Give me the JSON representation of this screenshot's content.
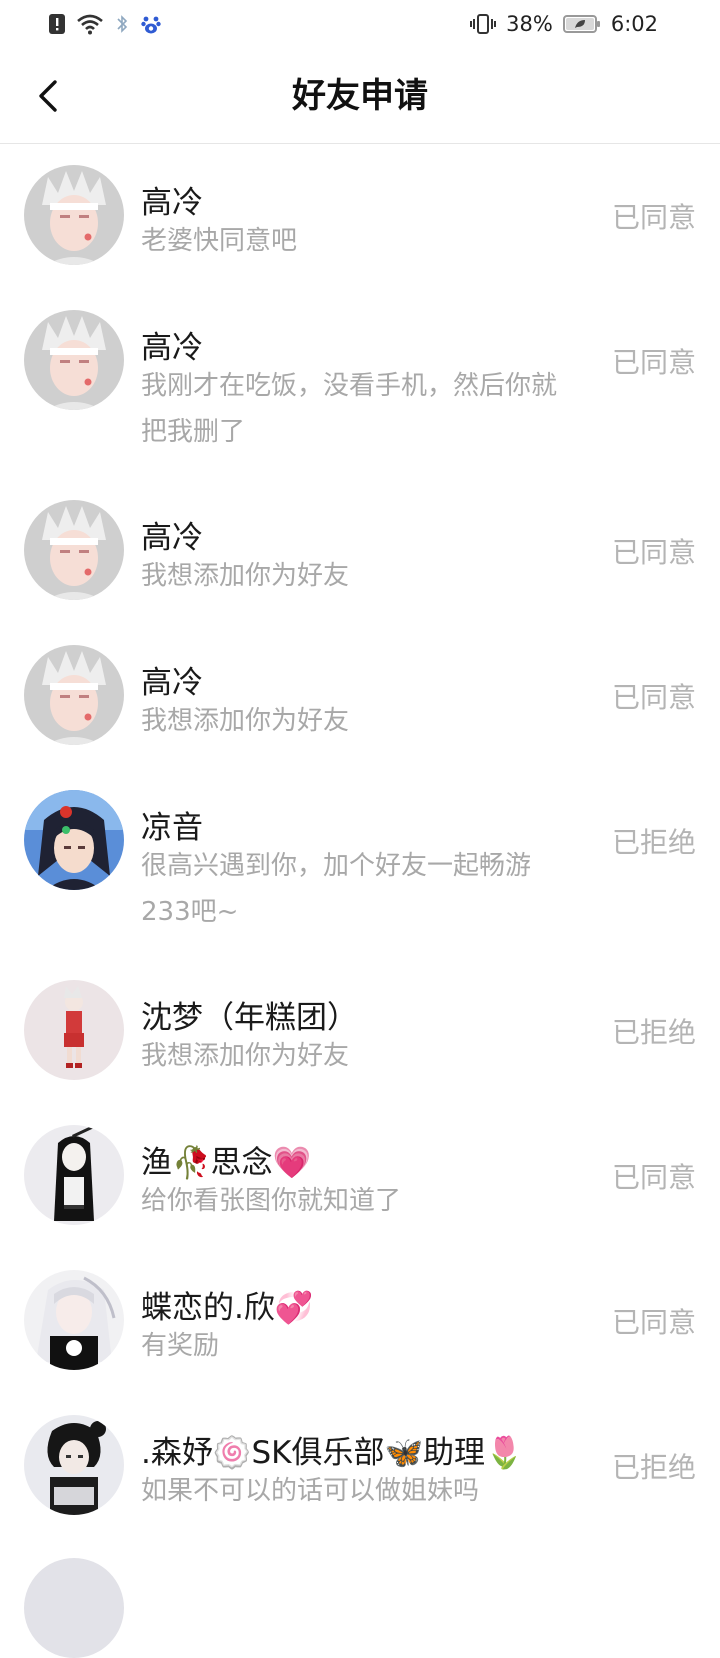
{
  "status_bar": {
    "battery": "38%",
    "time": "6:02",
    "icons": [
      "alert-icon",
      "wifi-icon",
      "bluetooth-icon",
      "baidu-paw-icon",
      "vibrate-icon",
      "battery-icon"
    ]
  },
  "header": {
    "back_icon": "chevron-left-icon",
    "title": "好友申请"
  },
  "requests": [
    {
      "name": "高冷",
      "message": "老婆快同意吧",
      "status": "已同意"
    },
    {
      "name": "高冷",
      "message": "我刚才在吃饭，没看手机，然后你就把我删了",
      "status": "已同意"
    },
    {
      "name": "高冷",
      "message": "我想添加你为好友",
      "status": "已同意"
    },
    {
      "name": "高冷",
      "message": "我想添加你为好友",
      "status": "已同意"
    },
    {
      "name": "凉音",
      "message": "很高兴遇到你，加个好友一起畅游233吧~",
      "status": "已拒绝"
    },
    {
      "name": "沈梦（年糕团）",
      "message": "我想添加你为好友",
      "status": "已拒绝"
    },
    {
      "name": "渔🥀思念💗",
      "message": "给你看张图你就知道了",
      "status": "已同意"
    },
    {
      "name": "蝶恋的.欣💞",
      "message": "有奖励",
      "status": "已同意"
    },
    {
      "name": ".森妤🍥SK俱乐部🦋助理🌷",
      "message": "如果不可以的话可以做姐妹吗",
      "status": "已拒绝"
    }
  ]
}
